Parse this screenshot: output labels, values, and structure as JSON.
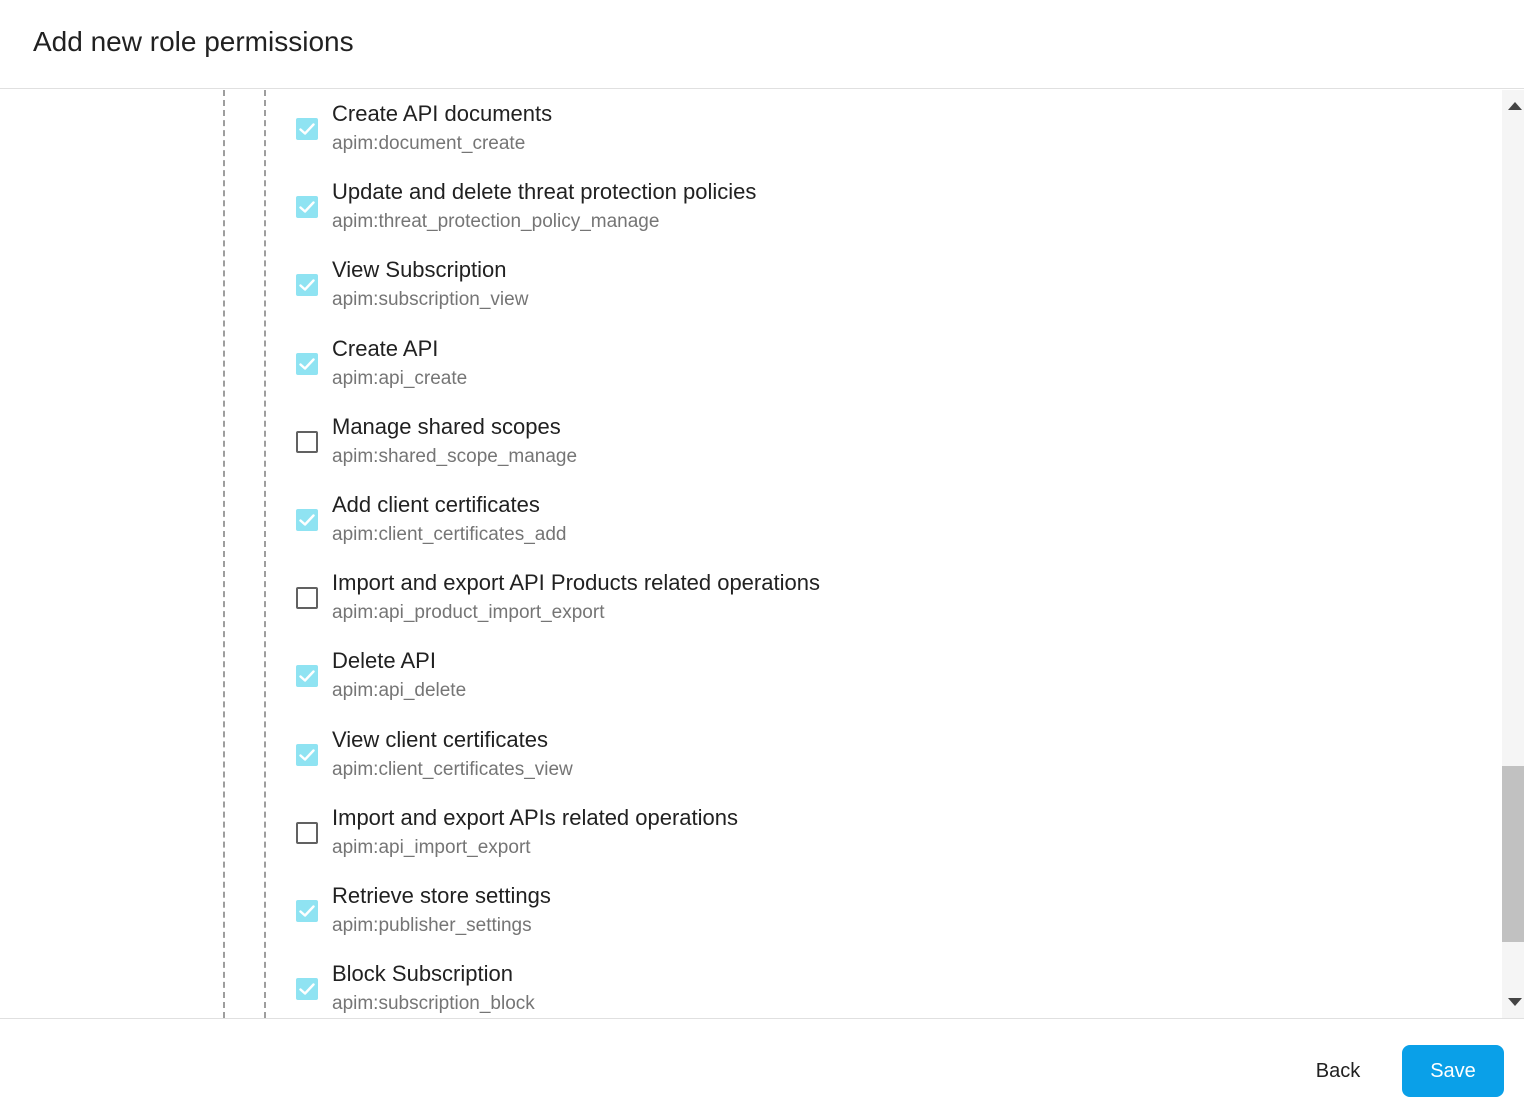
{
  "dialog": {
    "title": "Add new role permissions"
  },
  "permissions": [
    {
      "label": "Create API documents",
      "scope": "apim:document_create",
      "checked": true
    },
    {
      "label": "Update and delete threat protection policies",
      "scope": "apim:threat_protection_policy_manage",
      "checked": true
    },
    {
      "label": "View Subscription",
      "scope": "apim:subscription_view",
      "checked": true
    },
    {
      "label": "Create API",
      "scope": "apim:api_create",
      "checked": true
    },
    {
      "label": "Manage shared scopes",
      "scope": "apim:shared_scope_manage",
      "checked": false
    },
    {
      "label": "Add client certificates",
      "scope": "apim:client_certificates_add",
      "checked": true
    },
    {
      "label": "Import and export API Products related operations",
      "scope": "apim:api_product_import_export",
      "checked": false
    },
    {
      "label": "Delete API",
      "scope": "apim:api_delete",
      "checked": true
    },
    {
      "label": "View client certificates",
      "scope": "apim:client_certificates_view",
      "checked": true
    },
    {
      "label": "Import and export APIs related operations",
      "scope": "apim:api_import_export",
      "checked": false
    },
    {
      "label": "Retrieve store settings",
      "scope": "apim:publisher_settings",
      "checked": true
    },
    {
      "label": "Block Subscription",
      "scope": "apim:subscription_block",
      "checked": true
    }
  ],
  "footer": {
    "back_label": "Back",
    "save_label": "Save"
  },
  "colors": {
    "checked_fill": "#8fe3f2",
    "primary_button": "#0aa0e8"
  },
  "icons": {
    "checkbox_checked": "check-icon",
    "scroll_up": "triangle-up-icon",
    "scroll_down": "triangle-down-icon"
  }
}
